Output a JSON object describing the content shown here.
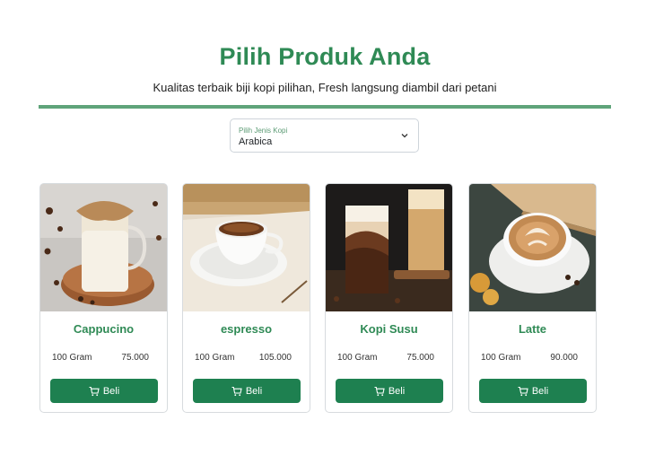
{
  "header": {
    "title": "Pilih Produk Anda",
    "subtitle": "Kualitas terbaik biji kopi pilihan, Fresh langsung diambil dari petani"
  },
  "filter": {
    "label": "Pilih Jenis Kopi",
    "selected": "Arabica",
    "icon": "chevron-down-icon"
  },
  "products": [
    {
      "name": "Cappucino",
      "weight": "100 Gram",
      "price": "75.000",
      "buy_label": "Beli"
    },
    {
      "name": "espresso",
      "weight": "100 Gram",
      "price": "105.000",
      "buy_label": "Beli"
    },
    {
      "name": "Kopi Susu",
      "weight": "100 Gram",
      "price": "75.000",
      "buy_label": "Beli"
    },
    {
      "name": "Latte",
      "weight": "100 Gram",
      "price": "90.000",
      "buy_label": "Beli"
    }
  ],
  "colors": {
    "accent": "#2f8a55",
    "button": "#1e8050",
    "divider": "#5fa47a"
  }
}
